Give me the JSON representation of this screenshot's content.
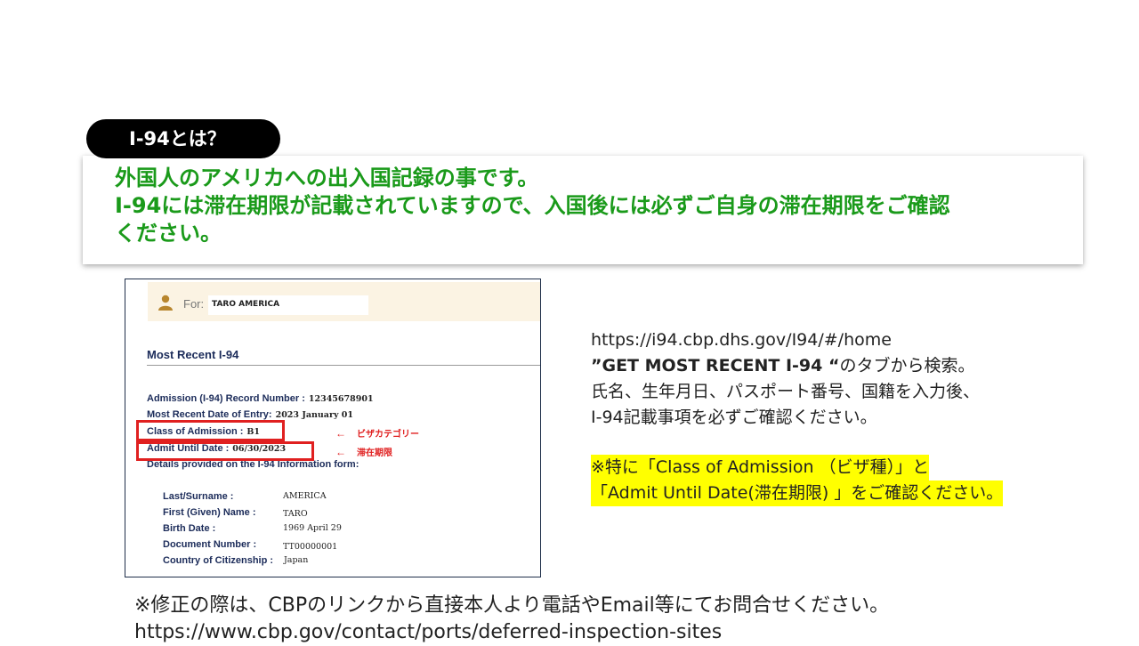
{
  "pill_label": "I-94とは？",
  "card": {
    "line1": "外国人のアメリカへの出入国記録の事です。",
    "line2": "I-94には滞在期限が記載されていますので、入国後には必ずご自身の滞在期限をご確認",
    "line3": "ください。"
  },
  "i94": {
    "for_label": "For:",
    "name": "TARO AMERICA",
    "title": "Most Recent I-94",
    "record_label": "Admission (I-94) Record Number :",
    "record_value": "12345678901",
    "entry_label": "Most Recent Date of Entry:",
    "entry_value": "2023 January 01",
    "class_label": "Class of Admission :",
    "class_value": "B1",
    "admit_label": "Admit Until Date :",
    "admit_value": "06/30/2023",
    "details_label": "Details provided on the I-94 Information form:",
    "annotations": {
      "arrow": "←",
      "visa_category": "ビザカテゴリー",
      "stay_limit": "滞在期限"
    },
    "details": [
      {
        "label": "Last/Surname :",
        "value": "AMERICA"
      },
      {
        "label": "First (Given) Name :",
        "value": "TARO"
      },
      {
        "label": "Birth Date :",
        "value": "1969 April 29"
      },
      {
        "label": "Document Number :",
        "value": "TT00000001"
      },
      {
        "label": "Country of Citizenship :",
        "value": "Japan"
      }
    ]
  },
  "info": {
    "url": "https://i94.cbp.dhs.gov/I94/#/home",
    "tab_name": "”GET MOST RECENT I-94 “",
    "tab_suffix": "のタブから検索。",
    "line3": "氏名、生年月日、パスポート番号、国籍を入力後、",
    "line4": "I-94記載事項を必ずご確認ください。"
  },
  "highlight": {
    "line1": "※特に「Class of Admission （ビザ種）」と",
    "line2": "「Admit Until Date(滞在期限) 」をご確認ください。"
  },
  "footer": {
    "line1": "※修正の際は、CBPのリンクから直接本人より電話やEmail等にてお問合せください。",
    "line2": "https://www.cbp.gov/contact/ports/deferred-inspection-sites"
  }
}
